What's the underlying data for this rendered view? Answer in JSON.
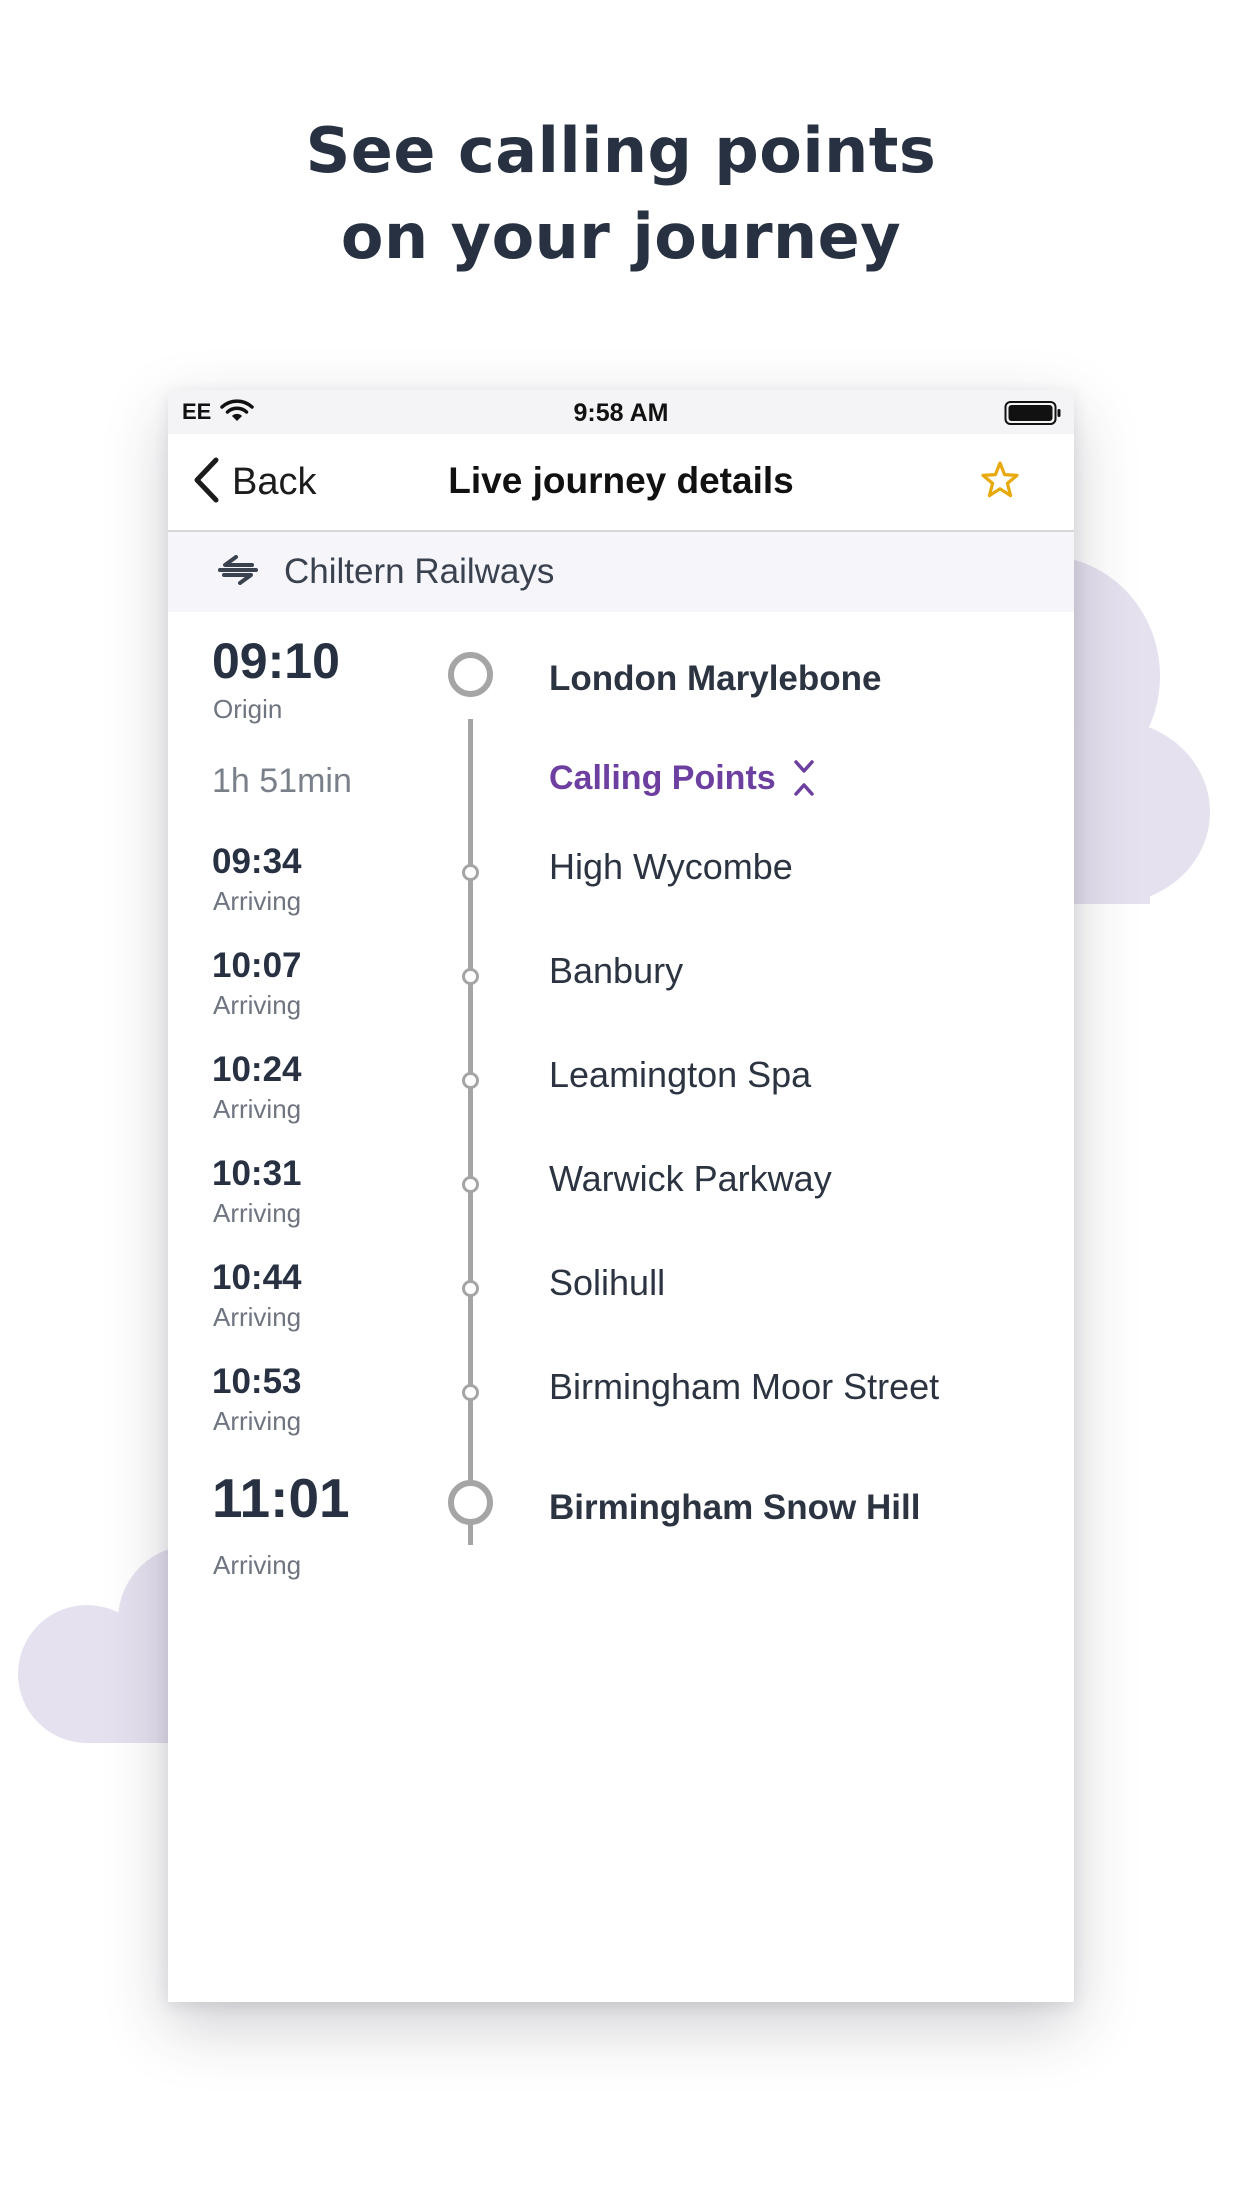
{
  "headline": {
    "line1": "See calling points",
    "line2": "on your journey"
  },
  "statusbar": {
    "carrier": "EE",
    "time": "9:58 AM",
    "wifi_icon": "wifi-icon",
    "battery_icon": "battery-icon"
  },
  "navbar": {
    "back_label": "Back",
    "title": "Live journey details",
    "favorite_icon": "star-icon"
  },
  "operator": {
    "name": "Chiltern Railways",
    "icon": "national-rail-icon"
  },
  "journey": {
    "origin": {
      "time": "09:10",
      "label": "Origin",
      "station": "London Marylebone"
    },
    "duration": "1h 51min",
    "calling_points_label": "Calling Points",
    "stops": [
      {
        "time": "09:34",
        "label": "Arriving",
        "station": "High Wycombe"
      },
      {
        "time": "10:07",
        "label": "Arriving",
        "station": "Banbury"
      },
      {
        "time": "10:24",
        "label": "Arriving",
        "station": "Leamington Spa"
      },
      {
        "time": "10:31",
        "label": "Arriving",
        "station": "Warwick Parkway"
      },
      {
        "time": "10:44",
        "label": "Arriving",
        "station": "Solihull"
      },
      {
        "time": "10:53",
        "label": "Arriving",
        "station": "Birmingham Moor Street"
      }
    ],
    "destination": {
      "time": "11:01",
      "label": "Arriving",
      "station": "Birmingham Snow Hill"
    }
  },
  "colors": {
    "accent_purple": "#6c3fa0",
    "star_gold": "#e8a90c",
    "timeline_gray": "#a5a5a5",
    "cloud": "#e6e1ef",
    "text_dark": "#273142"
  }
}
